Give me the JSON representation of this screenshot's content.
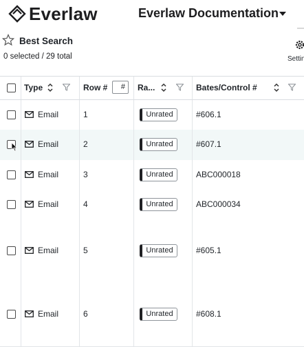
{
  "app": {
    "logo_text": "Everlaw",
    "project_title": "Everlaw Documentation"
  },
  "search": {
    "title": "Best Search",
    "selection_count": "0 selected / 29 total",
    "settings_label": "Settin"
  },
  "grid": {
    "columns": {
      "type": "Type",
      "row_num": "Row #",
      "rating": "Ra...",
      "bates": "Bates/Control #"
    },
    "row_filter_placeholder": "#",
    "rows": [
      {
        "type": "Email",
        "row": "1",
        "rating": "Unrated",
        "bates": "#606.1"
      },
      {
        "type": "Email",
        "row": "2",
        "rating": "Unrated",
        "bates": "#607.1"
      },
      {
        "type": "Email",
        "row": "3",
        "rating": "Unrated",
        "bates": "ABC000018"
      },
      {
        "type": "Email",
        "row": "4",
        "rating": "Unrated",
        "bates": "ABC000034"
      },
      {
        "type": "Email",
        "row": "5",
        "rating": "Unrated",
        "bates": "#605.1"
      },
      {
        "type": "Email",
        "row": "6",
        "rating": "Unrated",
        "bates": "#608.1"
      }
    ]
  }
}
